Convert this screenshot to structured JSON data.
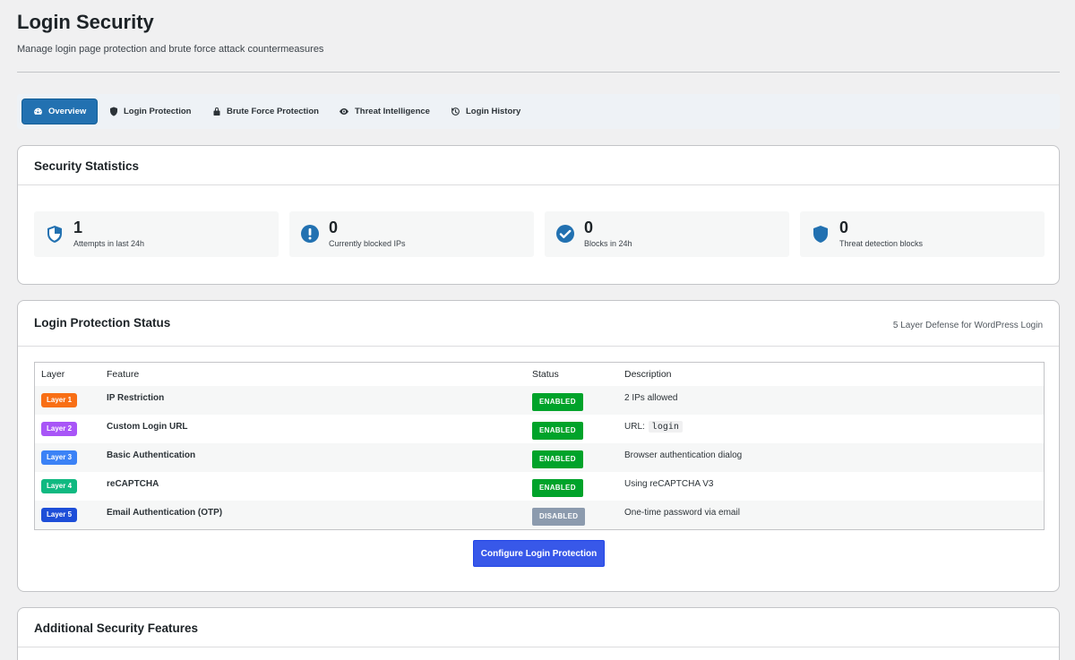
{
  "page": {
    "title": "Login Security",
    "subtitle": "Manage login page protection and brute force attack countermeasures"
  },
  "tabs": [
    {
      "label": "Overview",
      "icon": "dashboard-icon",
      "active": true
    },
    {
      "label": "Login Protection",
      "icon": "shield-icon",
      "active": false
    },
    {
      "label": "Brute Force Protection",
      "icon": "lock-icon",
      "active": false
    },
    {
      "label": "Threat Intelligence",
      "icon": "eye-icon",
      "active": false
    },
    {
      "label": "Login History",
      "icon": "history-icon",
      "active": false
    }
  ],
  "stats_card": {
    "title": "Security Statistics",
    "stats": [
      {
        "value": "1",
        "label": "Attempts in last 24h",
        "icon": "shield-half-icon"
      },
      {
        "value": "0",
        "label": "Currently blocked IPs",
        "icon": "warning-circle-icon"
      },
      {
        "value": "0",
        "label": "Blocks in 24h",
        "icon": "check-circle-icon"
      },
      {
        "value": "0",
        "label": "Threat detection blocks",
        "icon": "shield-icon"
      }
    ]
  },
  "protection_card": {
    "title": "Login Protection Status",
    "meta": "5 Layer Defense for WordPress Login",
    "columns": [
      "Layer",
      "Feature",
      "Status",
      "Description"
    ],
    "rows": [
      {
        "layer": "Layer 1",
        "layer_color": "#f86f15",
        "feature": "IP Restriction",
        "status": "ENABLED",
        "status_color": "#00a32a",
        "description": "2 IPs allowed",
        "code": ""
      },
      {
        "layer": "Layer 2",
        "layer_color": "#a855f7",
        "feature": "Custom Login URL",
        "status": "ENABLED",
        "status_color": "#00a32a",
        "description": "URL:",
        "code": "login"
      },
      {
        "layer": "Layer 3",
        "layer_color": "#3b82f6",
        "feature": "Basic Authentication",
        "status": "ENABLED",
        "status_color": "#00a32a",
        "description": "Browser authentication dialog",
        "code": ""
      },
      {
        "layer": "Layer 4",
        "layer_color": "#10b981",
        "feature": "reCAPTCHA",
        "status": "ENABLED",
        "status_color": "#00a32a",
        "description": "Using reCAPTCHA V3",
        "code": ""
      },
      {
        "layer": "Layer 5",
        "layer_color": "#1d4ed8",
        "feature": "Email Authentication (OTP)",
        "status": "DISABLED",
        "status_color": "#8c9bae",
        "description": "One-time password via email",
        "code": ""
      }
    ],
    "button_label": "Configure Login Protection"
  },
  "additional_card": {
    "title": "Additional Security Features"
  }
}
